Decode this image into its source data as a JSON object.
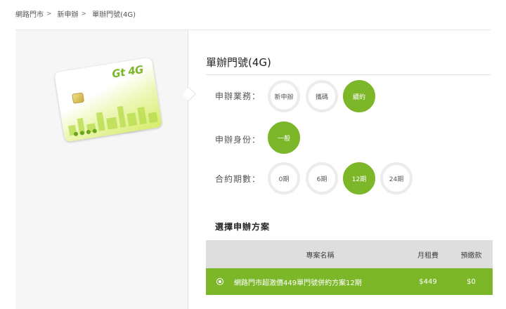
{
  "breadcrumb": {
    "items": [
      "網路門市",
      "新申辦",
      "單辦門號(4G)"
    ],
    "separator": ">"
  },
  "product": {
    "title": "單辦門號(4G)",
    "card_logo": "Gt 4G"
  },
  "options": {
    "business": {
      "label": "申辦業務：",
      "items": [
        "新申辦",
        "攜碼",
        "續約"
      ],
      "selected": "續約"
    },
    "identity": {
      "label": "申辦身份：",
      "items": [
        "一般"
      ],
      "selected": "一般"
    },
    "contract": {
      "label": "合約期數：",
      "items": [
        "0期",
        "6期",
        "12期",
        "24期"
      ],
      "selected": "12期"
    }
  },
  "plan": {
    "section_title": "選擇申辦方案",
    "headers": {
      "name": "專案名稱",
      "rent": "月租費",
      "prepay": "預繳款"
    },
    "rows": [
      {
        "name": "網路門市超激價449單門號併約方案12期",
        "rent": "$449",
        "prepay": "$0",
        "selected": true
      }
    ]
  },
  "colors": {
    "accent": "#7cb72a",
    "table_header": "#dedede",
    "panel_bg": "#f6f6f6"
  },
  "icons": [
    "chip-icon",
    "radio-selected-icon"
  ]
}
